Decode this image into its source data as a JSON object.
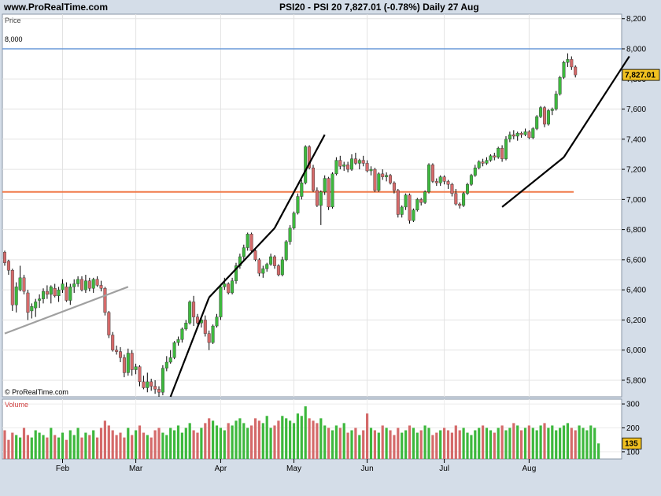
{
  "header": {
    "site": "www.ProRealTime.com",
    "title": "PSI20 - PSI 20    7,827.01 (-0.78%)    Daily  27 Aug"
  },
  "price_panel": {
    "label": "Price",
    "copyright": "© ProRealTime.com"
  },
  "volume_panel": {
    "label": "Volume"
  },
  "colors": {
    "up": "#3db83d",
    "down": "#d46a6a",
    "resistance": "#6a9ad8",
    "support": "#f07a4a",
    "trendline_main": "#000000",
    "trendline_grey": "#a0a0a0",
    "price_tag": "#f0c020"
  },
  "chart_data": [
    {
      "type": "candlestick",
      "title": "PSI20 - PSI 20",
      "last_value": "7,827.01",
      "last_change": "-0.78%",
      "frequency": "Daily",
      "date": "27 Aug",
      "y_ticks": [
        "5,800",
        "6,000",
        "6,200",
        "6,400",
        "6,600",
        "6,800",
        "7,000",
        "7,200",
        "7,400",
        "7,600",
        "7,800",
        "8,000",
        "8,200"
      ],
      "ylim": [
        5690,
        8230
      ],
      "x_ticks": [
        "Feb",
        "Mar",
        "Apr",
        "May",
        "Jun",
        "Jul",
        "Aug"
      ],
      "resistance_line": {
        "value": 8000,
        "label": "8,000"
      },
      "support_line": {
        "value": 7050
      },
      "trendlines": [
        {
          "from": [
            0,
            6110
          ],
          "to": [
            32,
            6420
          ]
        },
        {
          "from": [
            43,
            5690
          ],
          "to": [
            53,
            6350
          ]
        },
        {
          "from": [
            53,
            6350
          ],
          "to": [
            70,
            6810
          ]
        },
        {
          "from": [
            70,
            6810
          ],
          "to": [
            83,
            7430
          ]
        },
        {
          "from": [
            129,
            6950
          ],
          "to": [
            145,
            7280
          ]
        },
        {
          "from": [
            145,
            7280
          ],
          "to": [
            162,
            7950
          ]
        }
      ],
      "ohlc": [
        [
          6650,
          6660,
          6560,
          6580
        ],
        [
          6590,
          6600,
          6500,
          6530
        ],
        [
          6530,
          6540,
          6260,
          6300
        ],
        [
          6300,
          6450,
          6250,
          6420
        ],
        [
          6400,
          6560,
          6390,
          6480
        ],
        [
          6480,
          6500,
          6370,
          6390
        ],
        [
          6380,
          6400,
          6200,
          6250
        ],
        [
          6260,
          6310,
          6210,
          6290
        ],
        [
          6280,
          6340,
          6220,
          6320
        ],
        [
          6330,
          6370,
          6280,
          6340
        ],
        [
          6340,
          6410,
          6310,
          6390
        ],
        [
          6390,
          6430,
          6340,
          6370
        ],
        [
          6370,
          6430,
          6310,
          6420
        ],
        [
          6410,
          6440,
          6350,
          6360
        ],
        [
          6360,
          6420,
          6320,
          6400
        ],
        [
          6400,
          6470,
          6380,
          6440
        ],
        [
          6420,
          6450,
          6320,
          6330
        ],
        [
          6330,
          6440,
          6300,
          6420
        ],
        [
          6420,
          6470,
          6380,
          6440
        ],
        [
          6440,
          6490,
          6420,
          6470
        ],
        [
          6470,
          6490,
          6390,
          6400
        ],
        [
          6400,
          6500,
          6380,
          6460
        ],
        [
          6460,
          6480,
          6390,
          6410
        ],
        [
          6410,
          6480,
          6380,
          6470
        ],
        [
          6470,
          6490,
          6420,
          6430
        ],
        [
          6430,
          6460,
          6390,
          6410
        ],
        [
          6410,
          6420,
          6230,
          6250
        ],
        [
          6250,
          6260,
          6080,
          6100
        ],
        [
          6100,
          6120,
          5990,
          6000
        ],
        [
          6000,
          6030,
          5970,
          5990
        ],
        [
          5990,
          6020,
          5920,
          5950
        ],
        [
          5950,
          5970,
          5820,
          5850
        ],
        [
          5850,
          6010,
          5830,
          5980
        ],
        [
          5980,
          6000,
          5830,
          5870
        ],
        [
          5870,
          5910,
          5840,
          5890
        ],
        [
          5890,
          5900,
          5760,
          5790
        ],
        [
          5790,
          5830,
          5740,
          5750
        ],
        [
          5750,
          5850,
          5720,
          5790
        ],
        [
          5790,
          5810,
          5730,
          5760
        ],
        [
          5760,
          5800,
          5710,
          5740
        ],
        [
          5740,
          5760,
          5690,
          5720
        ],
        [
          5720,
          5900,
          5700,
          5880
        ],
        [
          5880,
          5960,
          5860,
          5920
        ],
        [
          5920,
          6000,
          5910,
          5950
        ],
        [
          5950,
          6060,
          5940,
          6050
        ],
        [
          6050,
          6090,
          6030,
          6070
        ],
        [
          6070,
          6150,
          6050,
          6140
        ],
        [
          6140,
          6200,
          6130,
          6180
        ],
        [
          6180,
          6330,
          6170,
          6320
        ],
        [
          6320,
          6360,
          6160,
          6220
        ],
        [
          6220,
          6240,
          6170,
          6180
        ],
        [
          6180,
          6220,
          6150,
          6200
        ],
        [
          6200,
          6230,
          6090,
          6110
        ],
        [
          6110,
          6130,
          6000,
          6050
        ],
        [
          6050,
          6170,
          6040,
          6160
        ],
        [
          6160,
          6240,
          6150,
          6220
        ],
        [
          6220,
          6430,
          6200,
          6420
        ],
        [
          6420,
          6480,
          6400,
          6440
        ],
        [
          6440,
          6450,
          6370,
          6380
        ],
        [
          6380,
          6480,
          6370,
          6460
        ],
        [
          6460,
          6580,
          6440,
          6560
        ],
        [
          6560,
          6640,
          6540,
          6620
        ],
        [
          6620,
          6700,
          6600,
          6680
        ],
        [
          6680,
          6780,
          6660,
          6770
        ],
        [
          6770,
          6780,
          6650,
          6660
        ],
        [
          6660,
          6680,
          6590,
          6600
        ],
        [
          6600,
          6610,
          6490,
          6510
        ],
        [
          6510,
          6560,
          6480,
          6540
        ],
        [
          6540,
          6580,
          6520,
          6570
        ],
        [
          6570,
          6640,
          6560,
          6620
        ],
        [
          6620,
          6630,
          6540,
          6560
        ],
        [
          6560,
          6570,
          6490,
          6500
        ],
        [
          6500,
          6620,
          6490,
          6600
        ],
        [
          6600,
          6730,
          6590,
          6720
        ],
        [
          6720,
          6830,
          6700,
          6810
        ],
        [
          6810,
          6920,
          6800,
          6910
        ],
        [
          6910,
          7040,
          6900,
          7020
        ],
        [
          7020,
          7130,
          7000,
          7110
        ],
        [
          7110,
          7360,
          7100,
          7350
        ],
        [
          7350,
          7360,
          7200,
          7210
        ],
        [
          7210,
          7230,
          7050,
          7060
        ],
        [
          7060,
          7080,
          6950,
          6960
        ],
        [
          6960,
          7060,
          6830,
          7050
        ],
        [
          7050,
          7160,
          7030,
          7140
        ],
        [
          7140,
          7150,
          6930,
          6950
        ],
        [
          6950,
          7180,
          6940,
          7170
        ],
        [
          7170,
          7280,
          7160,
          7260
        ],
        [
          7260,
          7290,
          7200,
          7220
        ],
        [
          7220,
          7250,
          7190,
          7230
        ],
        [
          7230,
          7250,
          7180,
          7200
        ],
        [
          7200,
          7300,
          7190,
          7270
        ],
        [
          7270,
          7310,
          7230,
          7240
        ],
        [
          7240,
          7270,
          7200,
          7260
        ],
        [
          7260,
          7290,
          7220,
          7240
        ],
        [
          7240,
          7260,
          7180,
          7190
        ],
        [
          7190,
          7220,
          7160,
          7200
        ],
        [
          7200,
          7210,
          7050,
          7060
        ],
        [
          7060,
          7180,
          7050,
          7170
        ],
        [
          7170,
          7200,
          7130,
          7150
        ],
        [
          7150,
          7180,
          7120,
          7160
        ],
        [
          7160,
          7170,
          7100,
          7110
        ],
        [
          7110,
          7120,
          7040,
          7060
        ],
        [
          7060,
          7070,
          6880,
          6900
        ],
        [
          6900,
          6960,
          6880,
          6950
        ],
        [
          6950,
          7040,
          6930,
          7030
        ],
        [
          7030,
          7040,
          6840,
          6860
        ],
        [
          6860,
          6940,
          6850,
          6930
        ],
        [
          6930,
          7010,
          6920,
          7000
        ],
        [
          7000,
          7010,
          6960,
          6980
        ],
        [
          6980,
          7060,
          6970,
          7050
        ],
        [
          7050,
          7240,
          7040,
          7230
        ],
        [
          7230,
          7240,
          7110,
          7120
        ],
        [
          7120,
          7140,
          7090,
          7110
        ],
        [
          7110,
          7160,
          7090,
          7150
        ],
        [
          7150,
          7160,
          7100,
          7120
        ],
        [
          7120,
          7130,
          7070,
          7100
        ],
        [
          7100,
          7110,
          7020,
          7040
        ],
        [
          7040,
          7070,
          6960,
          6970
        ],
        [
          6970,
          6980,
          6940,
          6960
        ],
        [
          6960,
          7050,
          6950,
          7040
        ],
        [
          7040,
          7110,
          7030,
          7100
        ],
        [
          7100,
          7170,
          7090,
          7160
        ],
        [
          7160,
          7230,
          7150,
          7210
        ],
        [
          7210,
          7260,
          7200,
          7250
        ],
        [
          7250,
          7270,
          7220,
          7240
        ],
        [
          7240,
          7280,
          7230,
          7260
        ],
        [
          7260,
          7300,
          7250,
          7290
        ],
        [
          7290,
          7310,
          7260,
          7280
        ],
        [
          7280,
          7350,
          7270,
          7340
        ],
        [
          7340,
          7360,
          7250,
          7270
        ],
        [
          7270,
          7420,
          7260,
          7400
        ],
        [
          7400,
          7450,
          7380,
          7430
        ],
        [
          7430,
          7460,
          7400,
          7420
        ],
        [
          7420,
          7450,
          7390,
          7440
        ],
        [
          7440,
          7450,
          7410,
          7430
        ],
        [
          7430,
          7470,
          7420,
          7450
        ],
        [
          7450,
          7460,
          7400,
          7410
        ],
        [
          7410,
          7480,
          7400,
          7470
        ],
        [
          7470,
          7560,
          7460,
          7550
        ],
        [
          7550,
          7620,
          7540,
          7610
        ],
        [
          7610,
          7620,
          7480,
          7500
        ],
        [
          7500,
          7600,
          7490,
          7590
        ],
        [
          7590,
          7610,
          7560,
          7600
        ],
        [
          7600,
          7720,
          7590,
          7700
        ],
        [
          7700,
          7820,
          7690,
          7810
        ],
        [
          7810,
          7920,
          7800,
          7910
        ],
        [
          7910,
          7970,
          7880,
          7930
        ],
        [
          7930,
          7950,
          7860,
          7880
        ],
        [
          7880,
          7890,
          7810,
          7827.01
        ]
      ],
      "volume": {
        "ticks": [
          "100",
          "200",
          "300"
        ],
        "ylim": [
          70,
          320
        ],
        "last_label": "135",
        "values": [
          190,
          150,
          180,
          170,
          160,
          200,
          170,
          160,
          190,
          180,
          170,
          160,
          200,
          170,
          160,
          180,
          150,
          190,
          170,
          200,
          160,
          180,
          170,
          190,
          160,
          200,
          230,
          210,
          190,
          170,
          180,
          160,
          200,
          170,
          190,
          210,
          180,
          170,
          160,
          190,
          200,
          180,
          170,
          200,
          190,
          210,
          180,
          200,
          220,
          190,
          180,
          200,
          220,
          240,
          230,
          210,
          200,
          190,
          220,
          210,
          230,
          240,
          220,
          200,
          210,
          240,
          230,
          220,
          250,
          200,
          210,
          230,
          250,
          240,
          230,
          220,
          260,
          250,
          290,
          240,
          230,
          220,
          240,
          210,
          200,
          190,
          210,
          200,
          220,
          180,
          190,
          200,
          170,
          190,
          260,
          200,
          190,
          180,
          210,
          200,
          190,
          170,
          200,
          180,
          190,
          210,
          200,
          180,
          190,
          210,
          200,
          170,
          180,
          190,
          200,
          190,
          180,
          210,
          190,
          200,
          180,
          170,
          190,
          200,
          210,
          200,
          190,
          180,
          200,
          210,
          190,
          200,
          220,
          210,
          190,
          200,
          210,
          200,
          190,
          210,
          220,
          200,
          210,
          190,
          200,
          210,
          220,
          200,
          190,
          210,
          200,
          190,
          210,
          200,
          135
        ]
      }
    }
  ]
}
